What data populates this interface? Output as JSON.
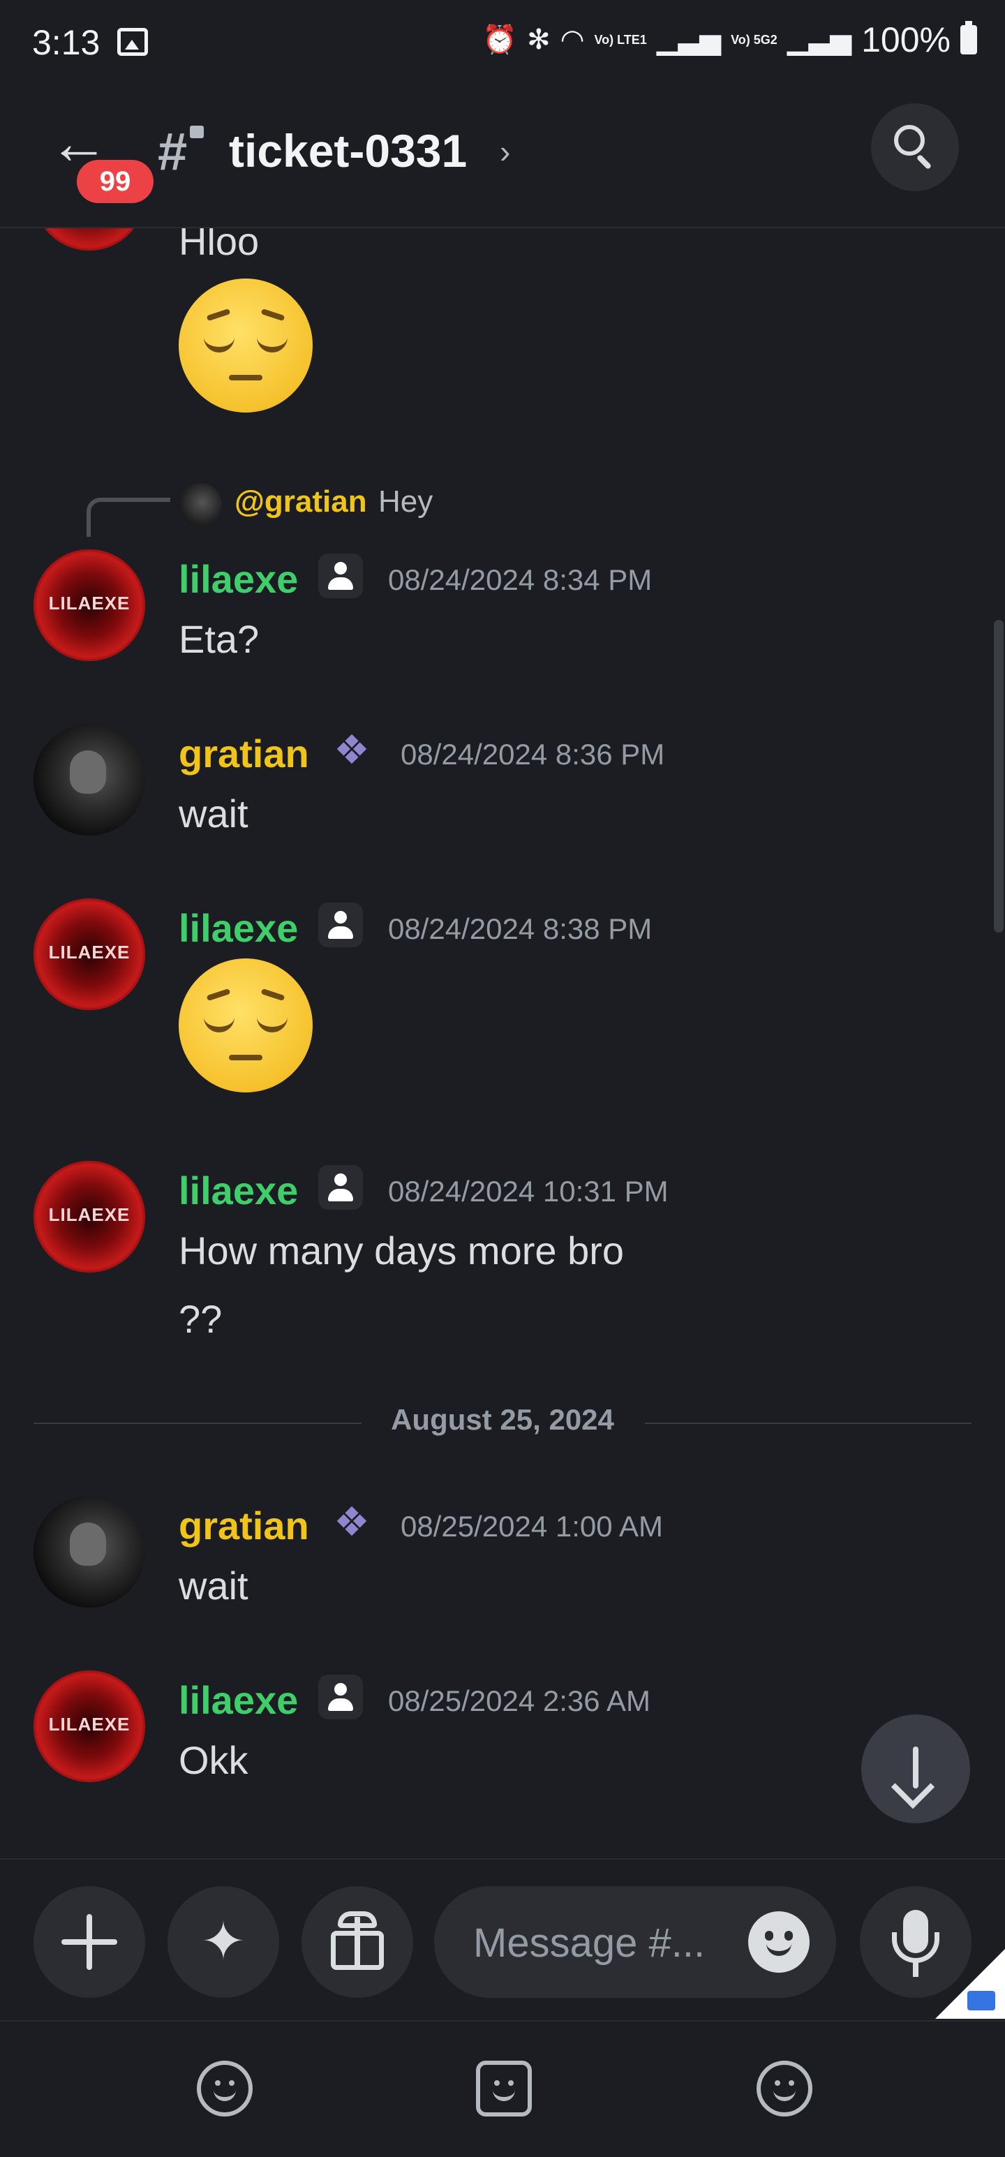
{
  "status_bar": {
    "time": "3:13",
    "net1": "Vo) LTE1",
    "net2": "Vo) 5G2",
    "battery": "100%",
    "icons": [
      "gallery-icon",
      "alarm-icon",
      "bluetooth-icon",
      "wifi-icon",
      "signal-icon",
      "battery-icon"
    ]
  },
  "header": {
    "back_badge": "99",
    "channel_name": "ticket-0331",
    "chevron": "›",
    "icons": [
      "back-arrow-icon",
      "locked-channel-icon",
      "search-icon"
    ]
  },
  "messages": {
    "partial_top": {
      "text": "Hloo",
      "emoji": "pensive-face"
    },
    "reply": {
      "mention": "@gratian",
      "text": "Hey"
    },
    "m1": {
      "user": "lilaexe",
      "time": "08/24/2024 8:34 PM",
      "text": "Eta?"
    },
    "m2": {
      "user": "gratian",
      "time": "08/24/2024 8:36 PM",
      "text": "wait"
    },
    "m3": {
      "user": "lilaexe",
      "time": "08/24/2024 8:38 PM",
      "emoji": "pensive-face"
    },
    "m4": {
      "user": "lilaexe",
      "time": "08/24/2024 10:31 PM",
      "text_line1": "How many days more bro",
      "text_line2": "??"
    },
    "date_divider": "August 25, 2024",
    "m5": {
      "user": "gratian",
      "time": "08/25/2024 1:00 AM",
      "text": "wait"
    },
    "m6": {
      "user": "lilaexe",
      "time": "08/25/2024 2:36 AM",
      "text": "Okk"
    },
    "avatar_text": "LILAEXE"
  },
  "composer": {
    "placeholder": "Message #...",
    "buttons": [
      "plus-icon",
      "apps-icon",
      "gift-icon",
      "emoji-icon",
      "mic-icon"
    ]
  },
  "colors": {
    "background": "#1c1d22",
    "lilaexe_name": "#3ecf6b",
    "gratian_name": "#f0c419",
    "badge": "#ed4245",
    "muted_text": "#949ba4"
  },
  "bottom_nav": {
    "icons": [
      "nav-emoji-icon-1",
      "nav-emoji-icon-2",
      "nav-emoji-icon-3"
    ]
  }
}
